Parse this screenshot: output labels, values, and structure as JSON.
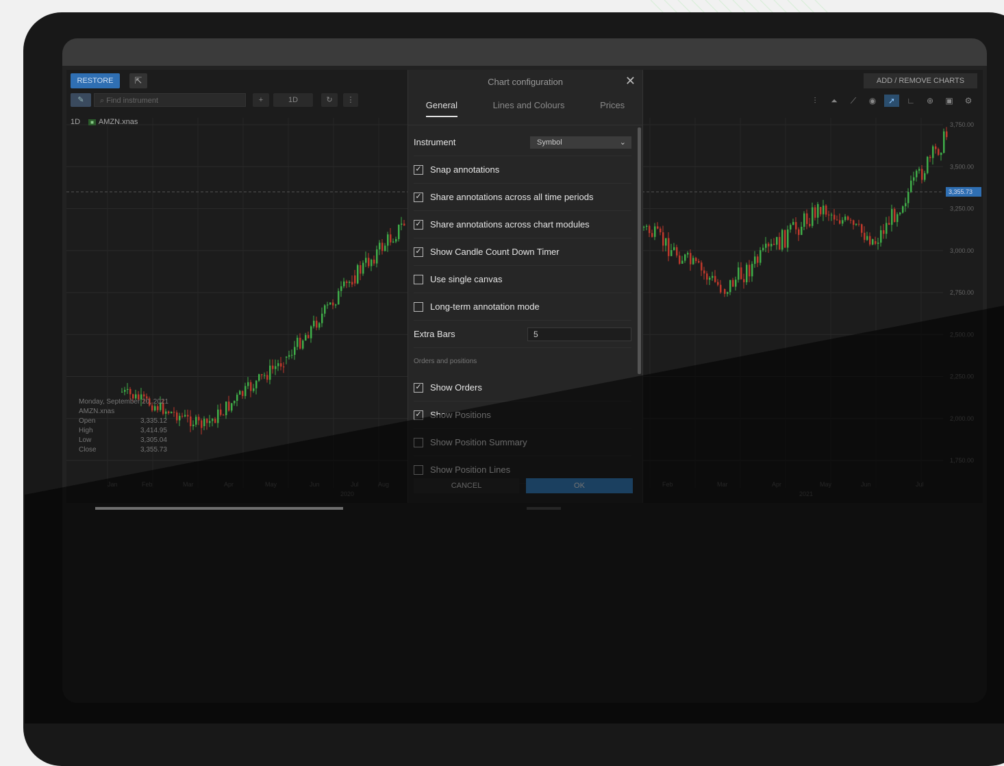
{
  "toolbar": {
    "restore": "RESTORE",
    "find_placeholder": "Find instrument",
    "interval": "1D",
    "add_remove": "ADD / REMOVE CHARTS"
  },
  "legend": {
    "period": "1D",
    "symbol": "AMZN.xnas"
  },
  "ohlc": {
    "date": "Monday, September 20, 2021",
    "symbol": "AMZN.xnas",
    "open_label": "Open",
    "open": "3,335.12",
    "high_label": "High",
    "high": "3,414.95",
    "low_label": "Low",
    "low": "3,305.04",
    "close_label": "Close",
    "close": "3,355.73"
  },
  "dialog": {
    "title": "Chart configuration",
    "tabs": [
      {
        "label": "General",
        "active": true
      },
      {
        "label": "Lines and Colours",
        "active": false
      },
      {
        "label": "Prices",
        "active": false
      }
    ],
    "instrument_label": "Instrument",
    "instrument_value": "Symbol",
    "options": [
      {
        "label": "Snap annotations",
        "checked": true
      },
      {
        "label": "Share annotations across all time periods",
        "checked": true
      },
      {
        "label": "Share annotations across chart modules",
        "checked": true
      },
      {
        "label": "Show Candle Count Down Timer",
        "checked": true
      },
      {
        "label": "Use single canvas",
        "checked": false
      },
      {
        "label": "Long-term annotation mode",
        "checked": false
      }
    ],
    "extra_bars_label": "Extra Bars",
    "extra_bars_value": "5",
    "section_label": "Orders and positions",
    "order_options": [
      {
        "label": "Show Orders",
        "checked": true
      },
      {
        "label": "Show Positions",
        "checked": true
      },
      {
        "label": "Show Position Summary",
        "checked": false
      },
      {
        "label": "Show Position Lines",
        "checked": false
      }
    ],
    "cancel": "CANCEL",
    "ok": "OK"
  },
  "chart_data": {
    "type": "line",
    "x_left": [
      "Jan",
      "Feb",
      "Mar",
      "Apr",
      "May",
      "Jun",
      "Jul",
      "Aug"
    ],
    "x_right": [
      "Feb",
      "Mar",
      "Apr",
      "May",
      "Jun",
      "Jul"
    ],
    "year_label_left": "2020",
    "year_label_right": "2021",
    "y_ticks": [
      "3,750.00",
      "3,500.00",
      "3,250.00",
      "3,000.00",
      "2,750.00",
      "2,500.00",
      "2,250.00",
      "2,000.00",
      "1,750.00"
    ],
    "current_price": "3,355.73",
    "colors": {
      "up": "#3fae49",
      "down": "#c0392b",
      "accent": "#3d8fd6"
    }
  }
}
